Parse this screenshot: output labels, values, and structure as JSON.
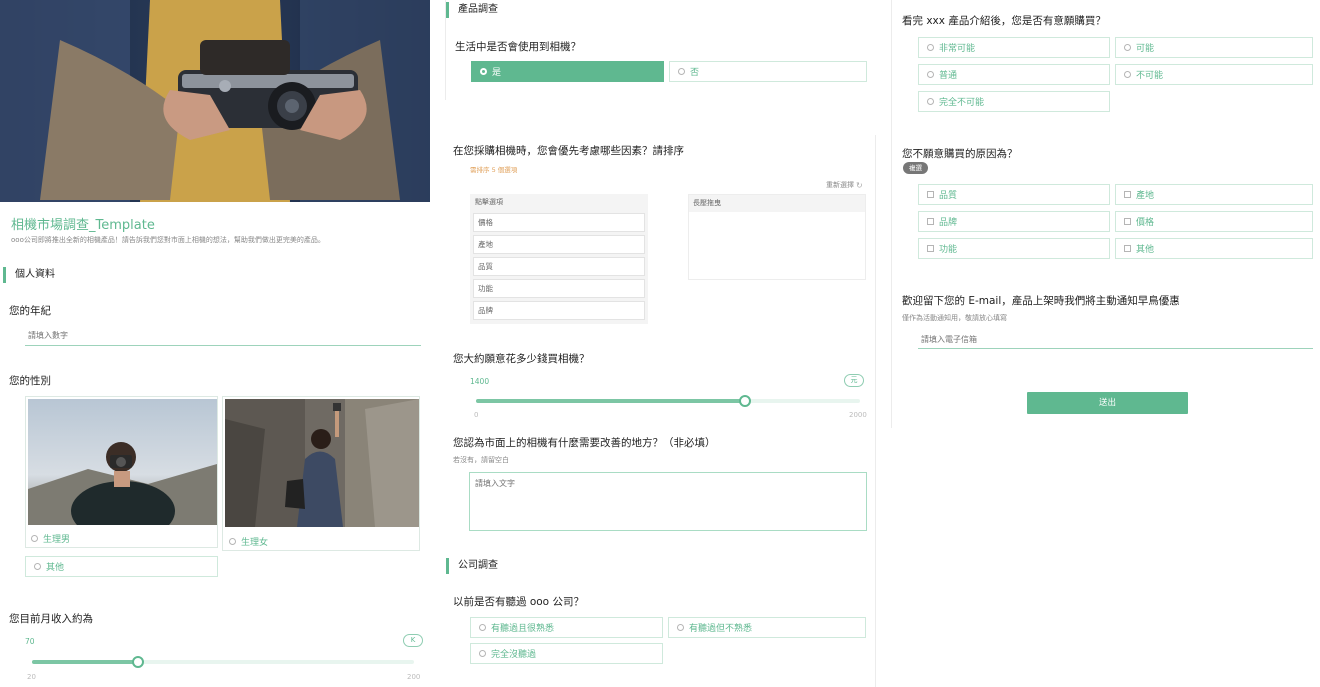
{
  "survey": {
    "title": "相機市場調查_Template",
    "description": "ooo公司即將推出全新的相機產品！請告訴我們您對市面上相機的想法，幫助我們做出更完美的產品。"
  },
  "personal": {
    "section_title": "個人資料",
    "age_question": "您的年紀",
    "age_placeholder": "請填入數字",
    "gender_question": "您的性別",
    "gender_options": [
      "生理男",
      "生理女",
      "其他"
    ],
    "income_question": "您目前月收入約為",
    "income_value": "70",
    "income_min": "20",
    "income_max": "200",
    "income_unit": "K"
  },
  "product": {
    "section_title": "產品調查",
    "use_camera_question": "生活中是否會使用到相機？",
    "use_camera_options": [
      "是",
      "否"
    ],
    "use_camera_selected": "是",
    "rank_question": "在您採購相機時，您會優先考慮哪些因素？請排序",
    "rank_hint": "需排序 5 個選項",
    "rank_reset": "重新選擇",
    "rank_left_header": "點擊選項",
    "rank_right_header": "長壓拖曳",
    "rank_items": [
      "價格",
      "產地",
      "品質",
      "功能",
      "品牌"
    ],
    "budget_question": "您大約願意花多少錢買相機？",
    "budget_value": "1400",
    "budget_min": "0",
    "budget_max": "2000",
    "budget_unit": "元",
    "improve_question": "您認為市面上的相機有什麼需要改善的地方？（非必填）",
    "improve_hint": "若沒有，請留空白",
    "improve_placeholder": "請填入文字"
  },
  "company": {
    "section_title": "公司調查",
    "heard_question": "以前是否有聽過 ooo 公司？",
    "heard_options": [
      "有聽過且很熟悉",
      "有聽過但不熟悉",
      "完全沒聽過"
    ]
  },
  "purchase": {
    "intent_question": "看完 xxx 產品介紹後，您是否有意願購買？",
    "intent_options": [
      "非常可能",
      "可能",
      "普通",
      "不可能",
      "完全不可能"
    ],
    "reason_question": "您不願意購買的原因為？",
    "reason_badge": "複選",
    "reason_options": [
      "品質",
      "產地",
      "品牌",
      "價格",
      "功能",
      "其他"
    ],
    "email_question": "歡迎留下您的 E-mail，產品上架時我們將主動通知早鳥優惠",
    "email_hint": "僅作為活動通知用，敬請放心填寫",
    "email_placeholder": "請填入電子信箱",
    "submit_label": "送出"
  },
  "colors": {
    "accent": "#5fb890",
    "accent_light": "#cfe9dc"
  },
  "sliders": {
    "income_fraction": 0.278,
    "budget_fraction": 0.7
  }
}
